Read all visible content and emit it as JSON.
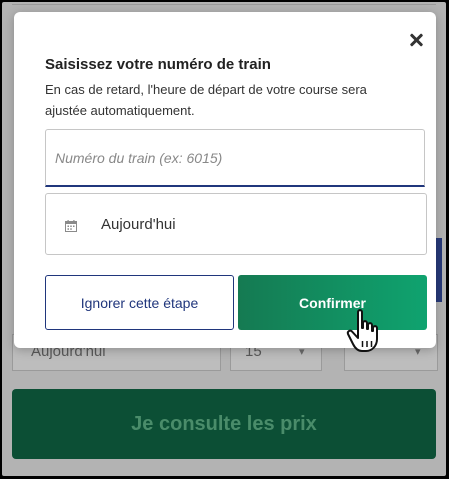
{
  "background": {
    "date_value": "Aujourd'hui",
    "time_value": "15",
    "cta_label": "Je consulte les prix"
  },
  "modal": {
    "title": "Saisissez votre numéro de train",
    "description": "En cas de retard, l'heure de départ de votre course sera ajustée automatiquement.",
    "train_input": {
      "value": "",
      "placeholder": "Numéro du train (ex: 6015)"
    },
    "date_field": {
      "icon": "calendar-icon",
      "value": "Aujourd'hui"
    },
    "skip_label": "Ignorer cette étape",
    "confirm_label": "Confirmer",
    "close_icon": "close-icon"
  },
  "colors": {
    "primary_blue": "#20367c",
    "confirm_green_start": "#157a52",
    "confirm_green_end": "#0fa36f",
    "cta_green_dimmed": "#0c4f35"
  }
}
